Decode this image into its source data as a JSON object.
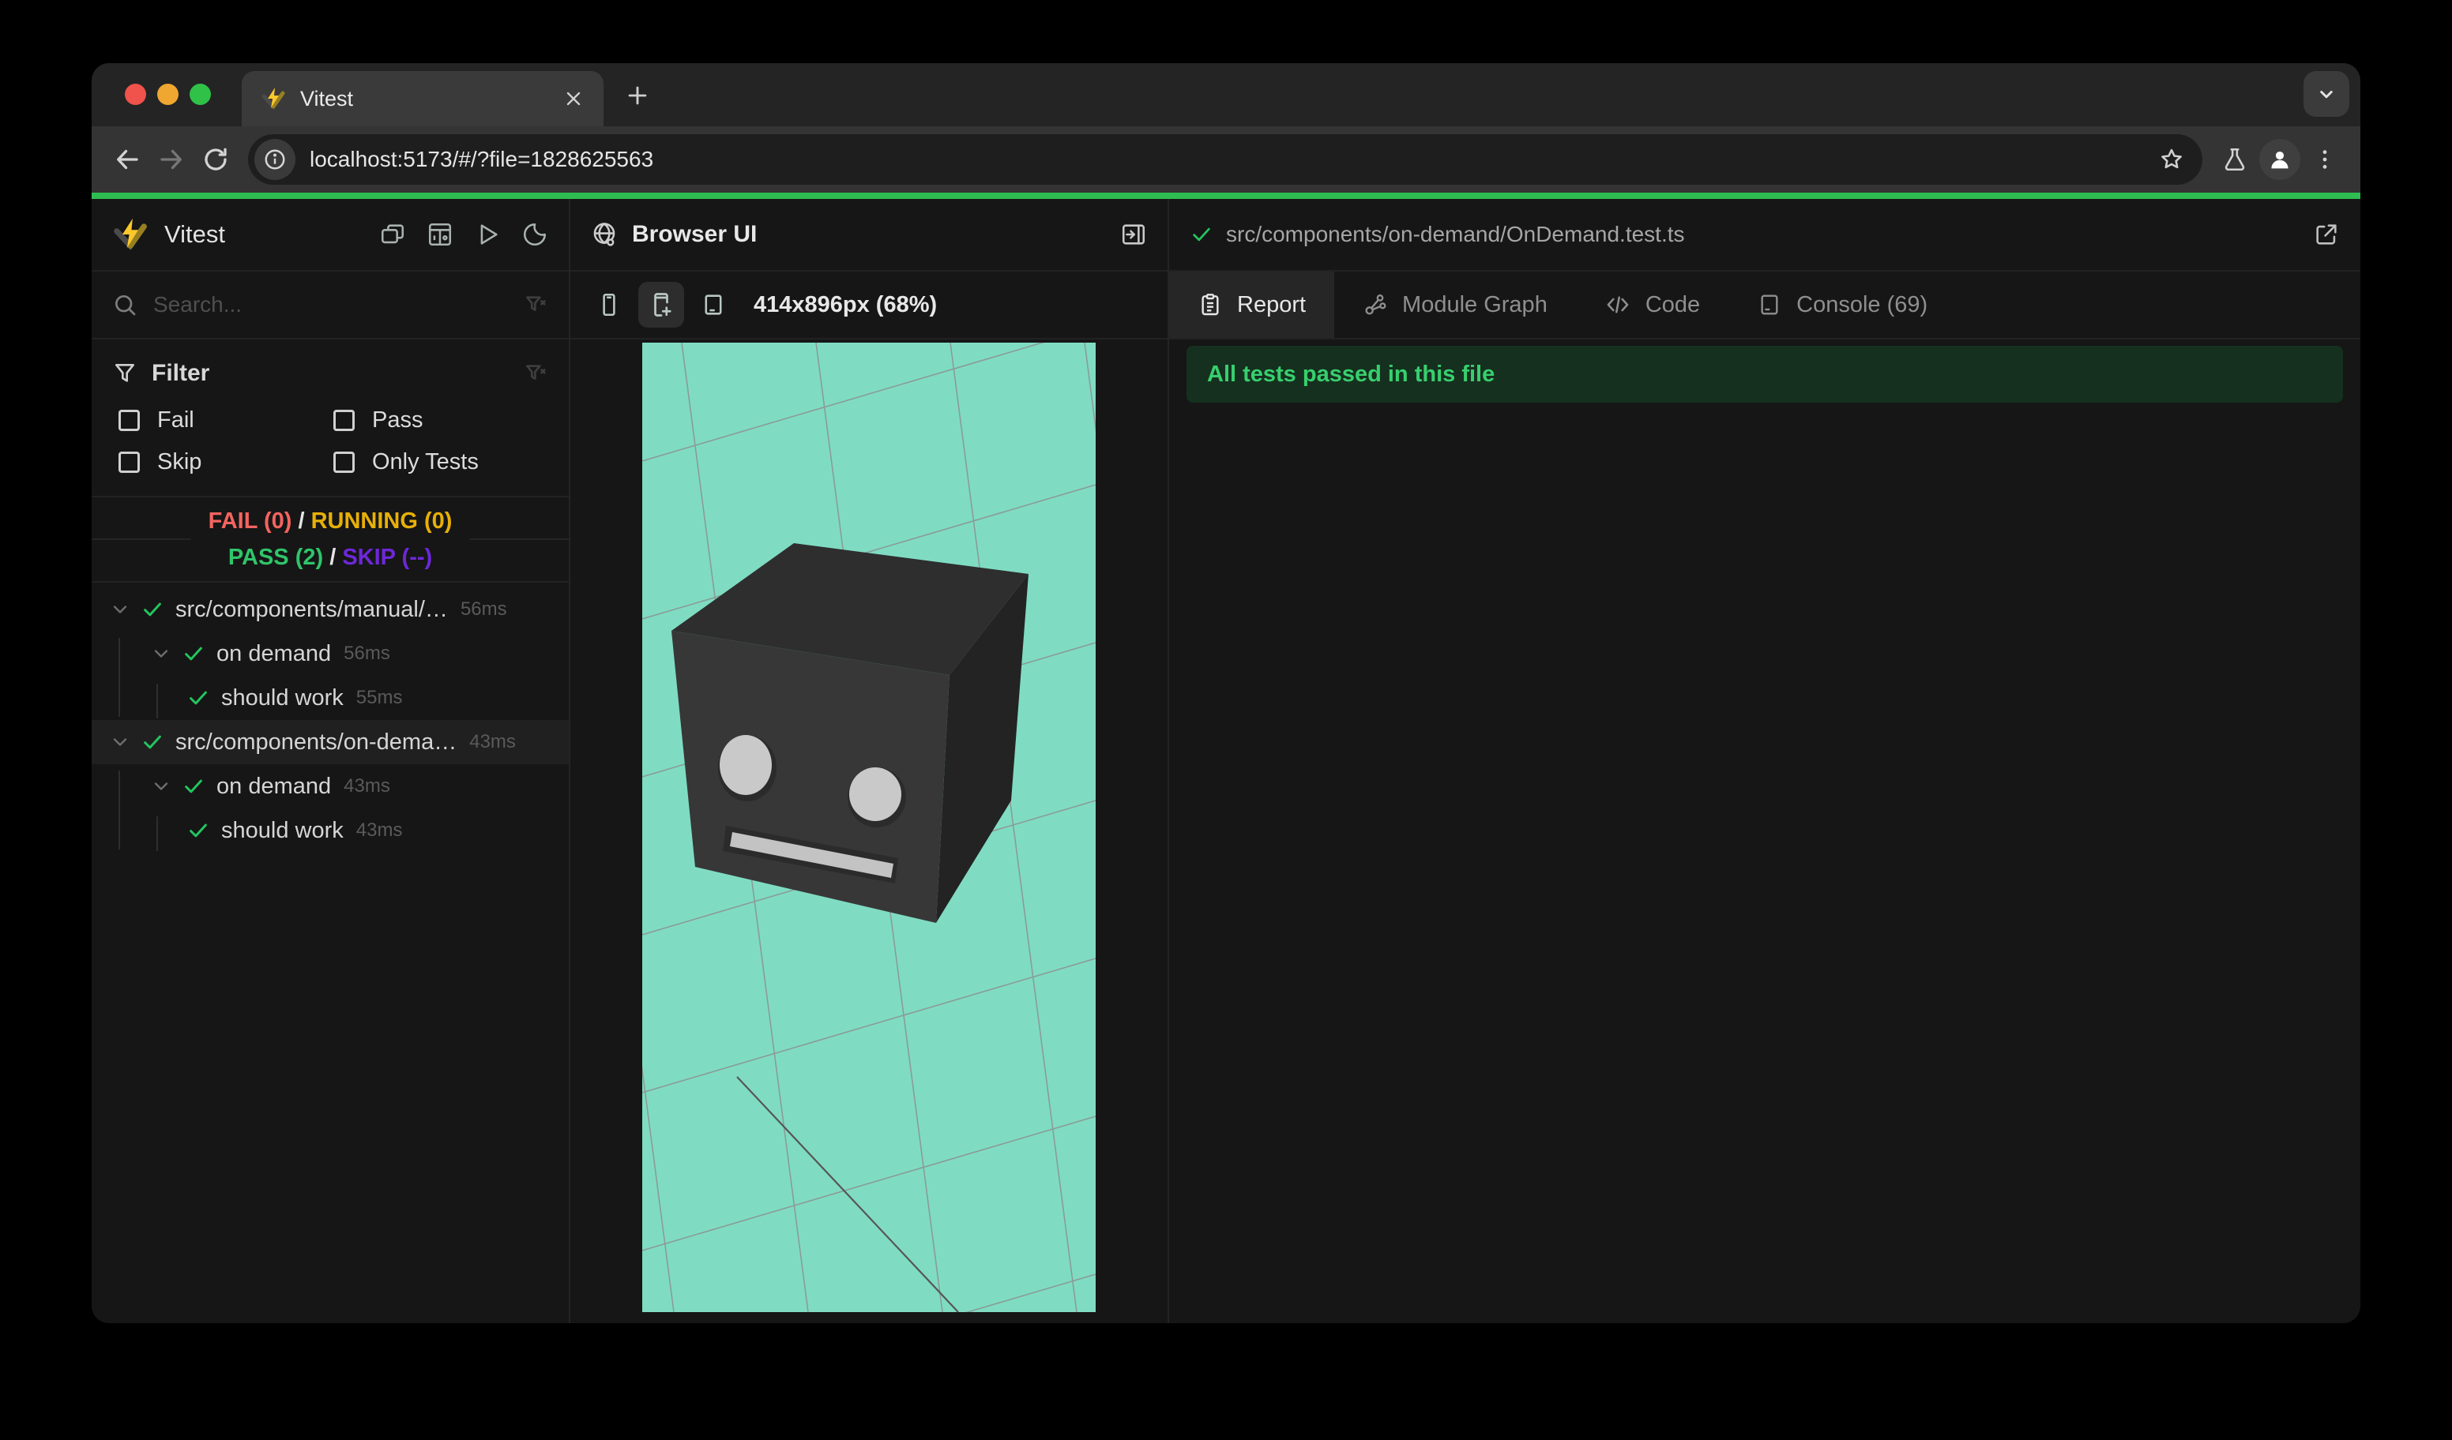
{
  "browser": {
    "tab_title": "Vitest",
    "url": "localhost:5173/#/?file=1828625563"
  },
  "sidebar": {
    "app_title": "Vitest",
    "search_placeholder": "Search...",
    "filter": {
      "title": "Filter",
      "options": [
        {
          "label": "Fail",
          "checked": false
        },
        {
          "label": "Pass",
          "checked": false
        },
        {
          "label": "Skip",
          "checked": false
        },
        {
          "label": "Only Tests",
          "checked": false
        }
      ]
    },
    "summary": {
      "fail": "FAIL (0)",
      "running": "RUNNING (0)",
      "pass": "PASS (2)",
      "skip": "SKIP (--)",
      "separator": "/"
    },
    "tree": [
      {
        "label": "src/components/manual/…",
        "duration": "56ms",
        "status": "pass"
      },
      {
        "label": "on demand",
        "duration": "56ms",
        "status": "pass"
      },
      {
        "label": "should work",
        "duration": "55ms",
        "status": "pass"
      },
      {
        "label": "src/components/on-dema…",
        "duration": "43ms",
        "status": "pass"
      },
      {
        "label": "on demand",
        "duration": "43ms",
        "status": "pass"
      },
      {
        "label": "should work",
        "duration": "43ms",
        "status": "pass"
      }
    ]
  },
  "preview": {
    "panel_title": "Browser UI",
    "viewport_label": "414x896px (68%)"
  },
  "report": {
    "file_path": "src/components/on-demand/OnDemand.test.ts",
    "tabs": [
      {
        "label": "Report"
      },
      {
        "label": "Module Graph"
      },
      {
        "label": "Code"
      },
      {
        "label": "Console (69)"
      }
    ],
    "active_tab": "Report",
    "banner": "All tests passed in this file"
  },
  "scene": {
    "background": "#7fdcc2",
    "grid_line": "#8d8d8d",
    "cube_top": "#2e2e2e",
    "cube_front": "#373737",
    "cube_side": "#232323",
    "eye": "#c9c9c9",
    "mouth": "#c3c3c3"
  },
  "colors": {
    "progress_green": "#2fbd52",
    "fail_red": "#f4645f",
    "running_yellow": "#e7b008",
    "pass_green": "#2fc56a",
    "skip_purple": "#6d28d9",
    "banner_bg": "#15301f",
    "banner_text": "#38cf6e"
  }
}
